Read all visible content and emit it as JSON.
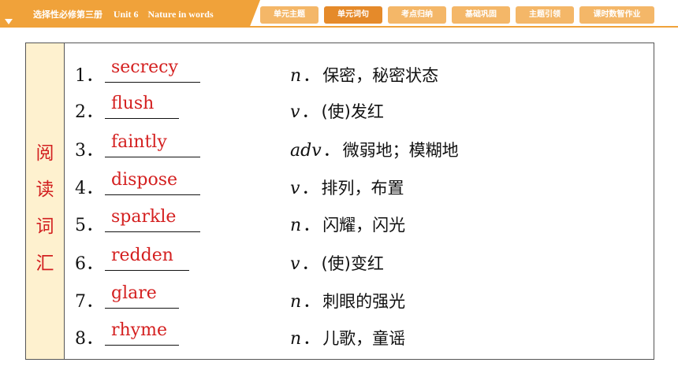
{
  "header": {
    "title_cn": "选择性必修第三册",
    "title_en": "Unit 6　Nature in words"
  },
  "tabs": [
    {
      "label": "单元主题",
      "active": false
    },
    {
      "label": "单元词句",
      "active": true
    },
    {
      "label": "考点归纳",
      "active": false
    },
    {
      "label": "基础巩固",
      "active": false
    },
    {
      "label": "主题引领",
      "active": false
    },
    {
      "label": "课时数智作业",
      "active": false
    }
  ],
  "section_label": [
    "阅",
    "读",
    "词",
    "汇"
  ],
  "items": [
    {
      "num": "1．",
      "word": "secrecy",
      "pos": "n",
      "meaning": "保密，秘密状态"
    },
    {
      "num": "2．",
      "word": "flush",
      "pos": "v",
      "meaning": "(使)发红"
    },
    {
      "num": "3．",
      "word": "faintly",
      "pos": "adv",
      "meaning": "微弱地；模糊地"
    },
    {
      "num": "4．",
      "word": "dispose",
      "pos": "v",
      "meaning": "排列，布置"
    },
    {
      "num": "5．",
      "word": "sparkle",
      "pos": "n",
      "meaning": "闪耀，闪光"
    },
    {
      "num": "6．",
      "word": "redden",
      "pos": "v",
      "meaning": "(使)变红"
    },
    {
      "num": "7．",
      "word": "glare",
      "pos": "n",
      "meaning": "刺眼的强光"
    },
    {
      "num": "8．",
      "word": "rhyme",
      "pos": "n",
      "meaning": "儿歌，童谣"
    }
  ],
  "colors": {
    "accent": "#f0a23a",
    "tab": "#f4b768",
    "tab_active": "#e58a2a",
    "side_bg": "#fef1cf",
    "answer": "#d42020"
  }
}
